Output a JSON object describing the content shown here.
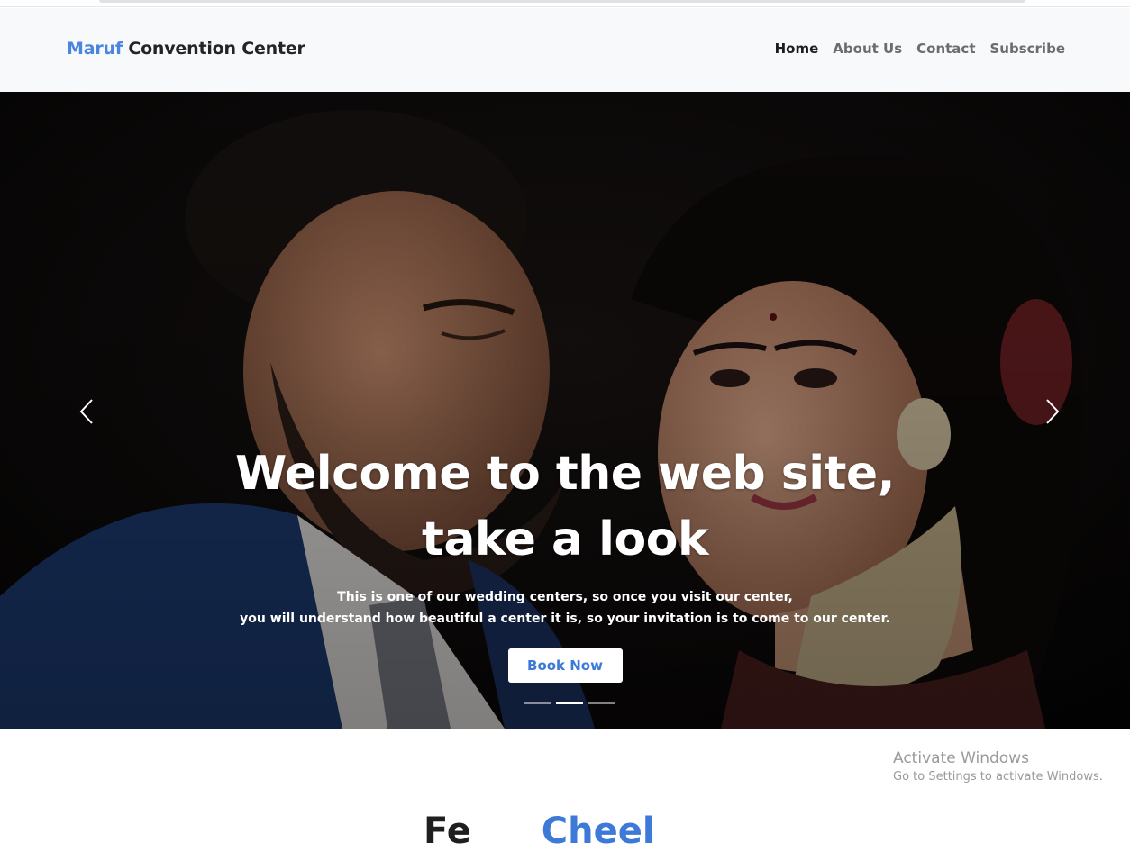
{
  "brand": {
    "accent": "Maruf",
    "rest": " Convention Center"
  },
  "nav": {
    "home": "Home",
    "about": "About Us",
    "contact": "Contact",
    "subscribe": "Subscribe"
  },
  "hero": {
    "title_line1": "Welcome to the web site,",
    "title_line2": "take a look",
    "text_line1": "This is one of our wedding centers, so once you visit our center,",
    "text_line2": "you will understand how beautiful a center it is, so your invitation is to come to our center.",
    "button": "Book Now",
    "slide_count": 3,
    "active_slide": 2,
    "prev_icon": "chevron-left-icon",
    "next_icon": "chevron-right-icon"
  },
  "watermark": {
    "title": "Activate Windows",
    "subtitle": "Go to Settings to activate Windows."
  },
  "next_section": {
    "word1": "Fe",
    "word2": "Cheel"
  },
  "colors": {
    "accent": "#4a86e0",
    "button_text": "#3d7ad8",
    "navbar_bg": "#f8f9fa"
  }
}
